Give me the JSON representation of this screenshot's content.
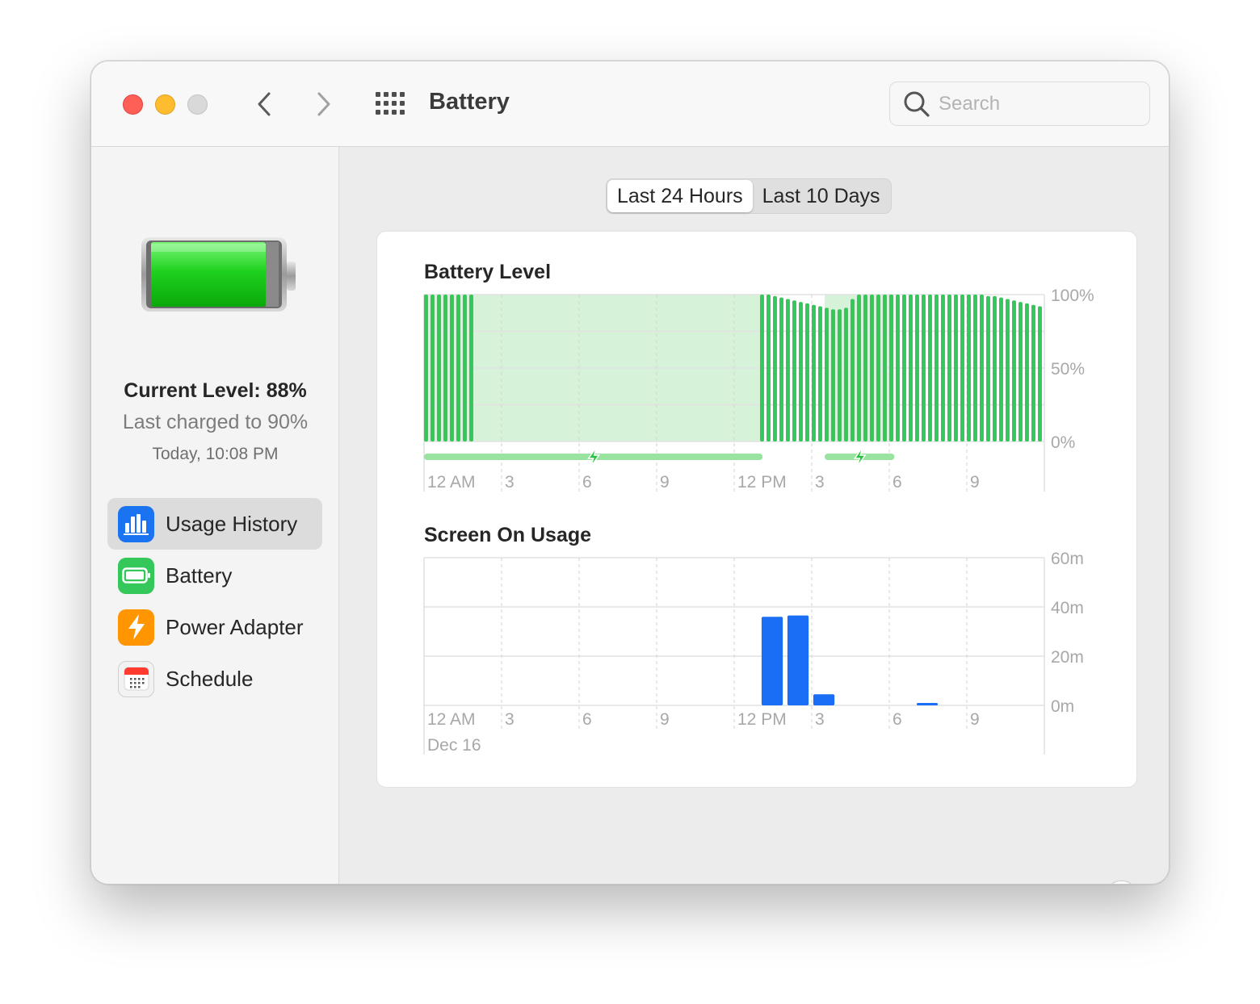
{
  "window": {
    "title": "Battery"
  },
  "search": {
    "placeholder": "Search"
  },
  "sidebar": {
    "current_level": "Current Level: 88%",
    "last_charged": "Last charged to 90%",
    "charged_time": "Today, 10:08 PM",
    "items": [
      {
        "label": "Usage History",
        "icon": "bar-chart-icon",
        "color": "#1a73f0",
        "active": true
      },
      {
        "label": "Battery",
        "icon": "battery-icon",
        "color": "#34c759",
        "active": false
      },
      {
        "label": "Power Adapter",
        "icon": "lightning-icon",
        "color": "#ff9500",
        "active": false
      },
      {
        "label": "Schedule",
        "icon": "calendar-icon",
        "color": "#ff3b30",
        "active": false
      }
    ]
  },
  "range_tabs": {
    "options": [
      "Last 24 Hours",
      "Last 10 Days"
    ],
    "selected": "Last 24 Hours"
  },
  "help": {
    "label": "?"
  },
  "chart_data": [
    {
      "type": "bar",
      "title": "Battery Level",
      "x_ticks": [
        "12 AM",
        "3",
        "6",
        "9",
        "12 PM",
        "3",
        "6",
        "9"
      ],
      "y_ticks": [
        "100%",
        "50%",
        "0%"
      ],
      "ylim": [
        0,
        100
      ],
      "hours_span": 24,
      "bar_color": "#34c759",
      "charging_color": "#97e39f",
      "charging_fill": "#d6f3d9",
      "series": [
        {
          "start_hour": 0.0,
          "step_hour": 0.25,
          "values": [
            100,
            100,
            100,
            100,
            100,
            100,
            100,
            100
          ]
        },
        {
          "start_hour": 13.0,
          "step_hour": 0.25,
          "values": [
            100,
            100,
            99,
            98,
            97,
            96,
            95,
            94,
            93,
            92,
            91,
            90,
            90,
            91,
            97,
            100,
            100,
            100,
            100,
            100,
            100,
            100,
            100,
            100,
            100,
            100,
            100,
            100,
            100,
            100,
            100,
            100,
            100,
            100,
            100,
            99,
            99,
            98,
            97,
            96,
            95,
            94,
            93,
            92
          ]
        }
      ],
      "charging_periods": [
        {
          "start_hour": 0.0,
          "end_hour": 13.1
        },
        {
          "start_hour": 15.5,
          "end_hour": 18.2
        }
      ]
    },
    {
      "type": "bar",
      "title": "Screen On Usage",
      "x_ticks": [
        "12 AM",
        "3",
        "6",
        "9",
        "12 PM",
        "3",
        "6",
        "9"
      ],
      "date_label": "Dec 16",
      "y_ticks": [
        "60m",
        "40m",
        "20m",
        "0m"
      ],
      "ylim": [
        0,
        60
      ],
      "bar_color": "#1a6ef5",
      "bars": [
        {
          "hour": 13,
          "minutes": 36
        },
        {
          "hour": 14,
          "minutes": 36.5
        },
        {
          "hour": 15,
          "minutes": 4.5
        },
        {
          "hour": 19,
          "minutes": 1
        }
      ]
    }
  ]
}
